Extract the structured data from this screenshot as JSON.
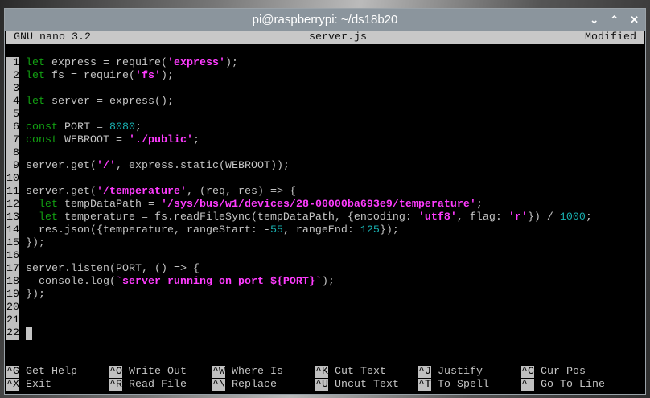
{
  "window": {
    "title": "pi@raspberrypi: ~/ds18b20",
    "buttons": [
      "⌄",
      "⌃",
      "✕"
    ]
  },
  "nano": {
    "version": "GNU nano 3.2",
    "filename": "server.js",
    "status": "Modified"
  },
  "code": [
    [
      {
        "t": "let",
        "c": "kw"
      },
      {
        "t": " express = require(",
        "c": ""
      },
      {
        "t": "'express'",
        "c": "str"
      },
      {
        "t": ");",
        "c": ""
      }
    ],
    [
      {
        "t": "let",
        "c": "kw"
      },
      {
        "t": " fs = require(",
        "c": ""
      },
      {
        "t": "'fs'",
        "c": "str"
      },
      {
        "t": ");",
        "c": ""
      }
    ],
    [],
    [
      {
        "t": "let",
        "c": "kw"
      },
      {
        "t": " server = express();",
        "c": ""
      }
    ],
    [],
    [
      {
        "t": "const",
        "c": "kw"
      },
      {
        "t": " PORT = ",
        "c": ""
      },
      {
        "t": "8080",
        "c": "num"
      },
      {
        "t": ";",
        "c": ""
      }
    ],
    [
      {
        "t": "const",
        "c": "kw"
      },
      {
        "t": " WEBROOT = ",
        "c": ""
      },
      {
        "t": "'./public'",
        "c": "str"
      },
      {
        "t": ";",
        "c": ""
      }
    ],
    [],
    [
      {
        "t": "server.get(",
        "c": ""
      },
      {
        "t": "'/'",
        "c": "str"
      },
      {
        "t": ", express.static(WEBROOT));",
        "c": ""
      }
    ],
    [],
    [
      {
        "t": "server.get(",
        "c": ""
      },
      {
        "t": "'/temperature'",
        "c": "str"
      },
      {
        "t": ", (req, res) => {",
        "c": ""
      }
    ],
    [
      {
        "t": "  ",
        "c": ""
      },
      {
        "t": "let",
        "c": "kw"
      },
      {
        "t": " tempDataPath = ",
        "c": ""
      },
      {
        "t": "'/sys/bus/w1/devices/28-00000ba693e9/temperature'",
        "c": "str"
      },
      {
        "t": ";",
        "c": ""
      }
    ],
    [
      {
        "t": "  ",
        "c": ""
      },
      {
        "t": "let",
        "c": "kw"
      },
      {
        "t": " temperature = fs.readFileSync(tempDataPath, {encoding: ",
        "c": ""
      },
      {
        "t": "'utf8'",
        "c": "str"
      },
      {
        "t": ", flag: ",
        "c": ""
      },
      {
        "t": "'r'",
        "c": "str"
      },
      {
        "t": "}) / ",
        "c": ""
      },
      {
        "t": "1000",
        "c": "num"
      },
      {
        "t": ";",
        "c": ""
      }
    ],
    [
      {
        "t": "  res.json({temperature, rangeStart: -",
        "c": ""
      },
      {
        "t": "55",
        "c": "num"
      },
      {
        "t": ", rangeEnd: ",
        "c": ""
      },
      {
        "t": "125",
        "c": "num"
      },
      {
        "t": "});",
        "c": ""
      }
    ],
    [
      {
        "t": "});",
        "c": ""
      }
    ],
    [],
    [
      {
        "t": "server.listen(PORT, () => {",
        "c": ""
      }
    ],
    [
      {
        "t": "  console.log(",
        "c": ""
      },
      {
        "t": "`server running on port ${PORT}`",
        "c": "str"
      },
      {
        "t": ");",
        "c": ""
      }
    ],
    [
      {
        "t": "});",
        "c": ""
      }
    ],
    [],
    [],
    []
  ],
  "shortcuts": [
    [
      {
        "key": "^G",
        "label": "Get Help"
      },
      {
        "key": "^O",
        "label": "Write Out"
      },
      {
        "key": "^W",
        "label": "Where Is"
      },
      {
        "key": "^K",
        "label": "Cut Text"
      },
      {
        "key": "^J",
        "label": "Justify"
      },
      {
        "key": "^C",
        "label": "Cur Pos"
      }
    ],
    [
      {
        "key": "^X",
        "label": "Exit"
      },
      {
        "key": "^R",
        "label": "Read File"
      },
      {
        "key": "^\\",
        "label": "Replace"
      },
      {
        "key": "^U",
        "label": "Uncut Text"
      },
      {
        "key": "^T",
        "label": "To Spell"
      },
      {
        "key": "^_",
        "label": "Go To Line"
      }
    ]
  ]
}
